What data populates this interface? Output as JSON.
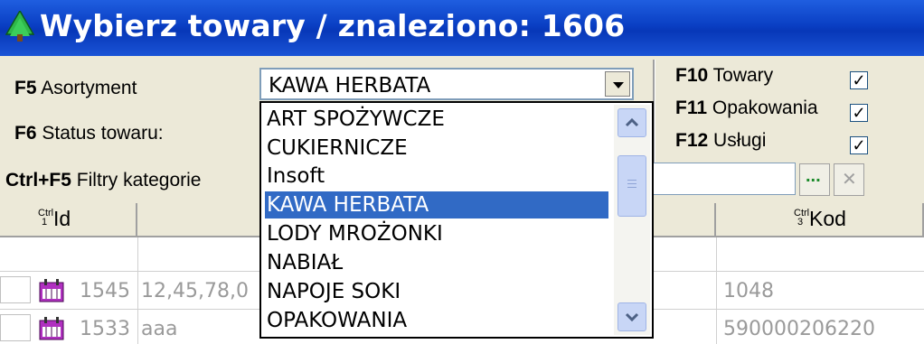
{
  "title": "Wybierz towary / znaleziono: 1606",
  "filters": {
    "asortyment_key": "F5",
    "asortyment_label": "Asortyment",
    "asortyment_value": "KAWA HERBATA",
    "status_key": "F6",
    "status_label": "Status towaru:",
    "kategorie_key": "Ctrl+F5",
    "kategorie_label": "Filtry kategorie"
  },
  "checks": [
    {
      "key": "F10",
      "label": "Towary",
      "checked": true
    },
    {
      "key": "F11",
      "label": "Opakowania",
      "checked": true
    },
    {
      "key": "F12",
      "label": "Usługi",
      "checked": true
    }
  ],
  "dropdown_items": [
    "ART SPOŻYWCZE",
    "CUKIERNICZE",
    "Insoft",
    "KAWA HERBATA",
    "LODY MROŻONKI",
    "NABIAŁ",
    "NAPOJE SOKI",
    "OPAKOWANIA"
  ],
  "selected_index": 3,
  "columns": {
    "id_ctrl": "Ctrl 1",
    "id": "Id",
    "kod_ctrl": "Ctrl 3",
    "kod": "Kod"
  },
  "rows": [
    {
      "id": "1545",
      "name": "12,45,78,0",
      "kod": "1048"
    },
    {
      "id": "1533",
      "name": "aaa",
      "kod": "590000206220"
    }
  ],
  "icons": {
    "dots": "...",
    "clear": "✕"
  }
}
